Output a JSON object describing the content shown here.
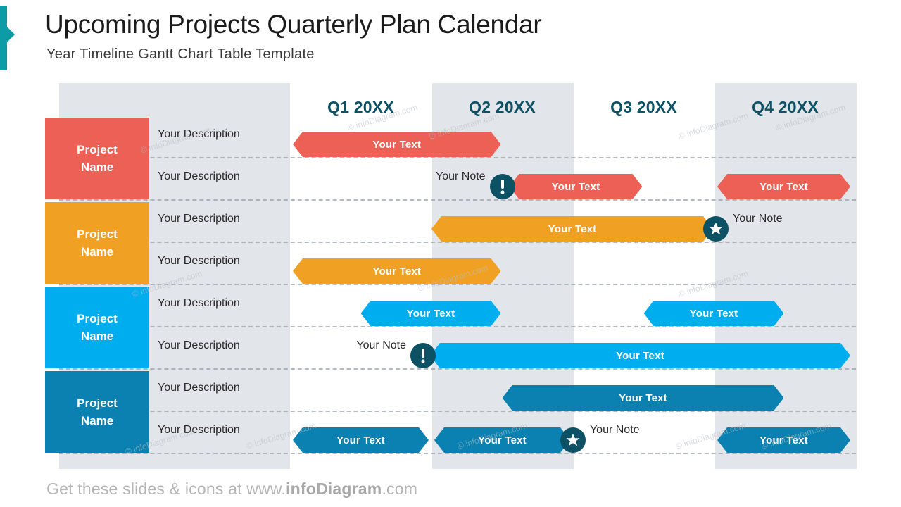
{
  "header": {
    "title": "Upcoming Projects Quarterly Plan Calendar",
    "subtitle": "Year Timeline Gantt Chart Table Template"
  },
  "footer": {
    "prefix": "Get these slides & icons at www.",
    "brand": "infoDiagram",
    "suffix": ".com"
  },
  "colors": {
    "teal_accent": "#0B9CA6",
    "marker": "#0C5164",
    "band": "#E2E5E9",
    "header_text": "#0C5164",
    "project_red": "#EC6055",
    "project_orange": "#F0A124",
    "project_cyan": "#00AEEF",
    "project_blue": "#0A81B0"
  },
  "watermark": "© infoDiagram.com",
  "chart_data": {
    "type": "table",
    "title": "Upcoming Projects Quarterly Plan Calendar",
    "xlabel": "",
    "ylabel": "",
    "grid": true,
    "legend_position": "none",
    "quarters": [
      {
        "label": "Q1 20XX",
        "shaded": false
      },
      {
        "label": "Q2 20XX",
        "shaded": true
      },
      {
        "label": "Q3 20XX",
        "shaded": false
      },
      {
        "label": "Q4 20XX",
        "shaded": true
      }
    ],
    "projects": [
      {
        "name_line1": "Project",
        "name_line2": "Name",
        "color": "#EC6055",
        "color_light": "#F29289",
        "tasks": [
          {
            "description": "Your Description",
            "bar_label": "Your Text",
            "start_q": 1.02,
            "end_q": 2.49,
            "note": null
          },
          {
            "description": "Your Description",
            "bar_label": "Your Text",
            "start_q": 2.55,
            "end_q": 3.49,
            "note": "Your Note",
            "note_icon": "exclamation-icon",
            "note_side": "left"
          },
          {
            "description": "",
            "bar_label": "Your Text",
            "start_q": 4.02,
            "end_q": 4.96,
            "note": null,
            "same_row_as_previous": true
          }
        ]
      },
      {
        "name_line1": "Project",
        "name_line2": "Name",
        "color": "#F0A124",
        "color_light": "#F2C177",
        "tasks": [
          {
            "description": "Your Description",
            "bar_label": "Your Text",
            "start_q": 2.0,
            "end_q": 3.99,
            "note": "Your Note",
            "note_icon": "star-icon",
            "note_side": "right"
          },
          {
            "description": "Your Description",
            "bar_label": "Your Text",
            "start_q": 1.02,
            "end_q": 2.49,
            "note": null
          }
        ]
      },
      {
        "name_line1": "Project",
        "name_line2": "Name",
        "color": "#00AEEF",
        "color_light": "#6ECCF3",
        "tasks": [
          {
            "description": "Your Description",
            "bar_label": "Your Text",
            "start_q": 1.5,
            "end_q": 2.49,
            "note": null
          },
          {
            "description": "",
            "bar_label": "Your Text",
            "start_q": 3.5,
            "end_q": 4.49,
            "note": null,
            "same_row_as_previous": true
          },
          {
            "description": "Your Description",
            "bar_label": "Your Text",
            "start_q": 1.99,
            "end_q": 4.96,
            "note": "Your Note",
            "note_icon": "exclamation-icon",
            "note_side": "left"
          }
        ]
      },
      {
        "name_line1": "Project",
        "name_line2": "Name",
        "color": "#0A81B0",
        "color_light": "#5FAFCD",
        "tasks": [
          {
            "description": "Your Description",
            "bar_label": "Your Text",
            "start_q": 2.5,
            "end_q": 4.49,
            "note": null
          },
          {
            "description": "Your Description",
            "bar_label": "Your Text",
            "start_q": 1.02,
            "end_q": 1.98,
            "note": null
          },
          {
            "description": "",
            "bar_label": "Your Text",
            "start_q": 2.02,
            "end_q": 2.98,
            "note": "Your Note",
            "note_icon": "star-icon",
            "note_side": "right",
            "same_row_as_previous": true
          },
          {
            "description": "",
            "bar_label": "Your Text",
            "start_q": 4.02,
            "end_q": 4.96,
            "note": null,
            "same_row_as_previous": true
          }
        ]
      }
    ]
  }
}
